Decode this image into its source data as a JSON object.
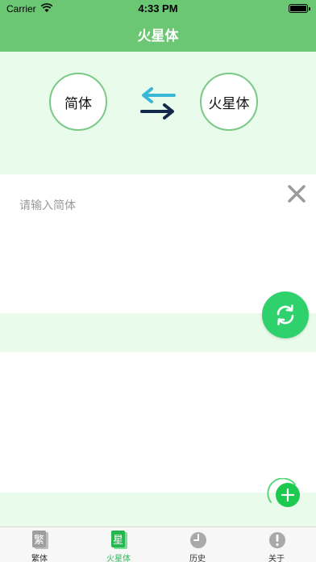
{
  "status": {
    "carrier": "Carrier",
    "time": "4:33 PM"
  },
  "nav": {
    "title": "火星体"
  },
  "converter": {
    "source_label": "简体",
    "target_label": "火星体"
  },
  "input": {
    "placeholder": "请输入简体",
    "value": ""
  },
  "tabs": [
    {
      "label": "繁体",
      "icon": "traditional-char-icon",
      "icon_char": "繁"
    },
    {
      "label": "火星体",
      "icon": "martian-char-icon",
      "icon_char": "星"
    },
    {
      "label": "历史",
      "icon": "clock-icon"
    },
    {
      "label": "关于",
      "icon": "info-icon"
    }
  ],
  "colors": {
    "header": "#6cc774",
    "accent": "#2fd16d",
    "band": "#e9fbea",
    "active_tab": "#2fb65a"
  }
}
